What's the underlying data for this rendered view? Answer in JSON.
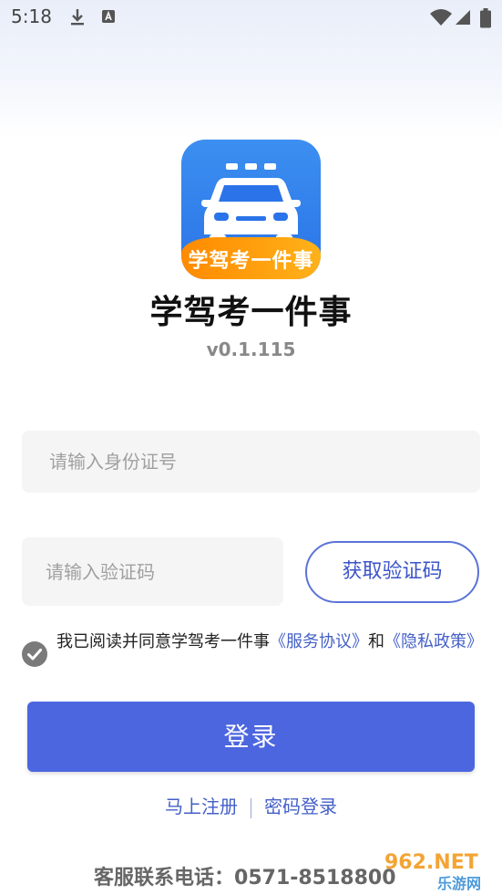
{
  "status_bar": {
    "time": "5:18",
    "icons": [
      "download-icon",
      "notification-a-icon",
      "wifi-icon",
      "signal-icon",
      "battery-icon"
    ]
  },
  "app": {
    "icon_banner_text": "学驾考一件事",
    "title": "学驾考一件事",
    "version": "v0.1.115"
  },
  "form": {
    "id_placeholder": "请输入身份证号",
    "id_value": "",
    "code_placeholder": "请输入验证码",
    "code_value": "",
    "get_code_label": "获取验证码"
  },
  "agreement": {
    "checked": true,
    "text_prefix": "我已阅读并同意学驾考一件事",
    "service_link": "《服务协议》",
    "and_text": "和",
    "privacy_link": "《隐私政策》"
  },
  "login_button": "登录",
  "links": {
    "register": "马上注册",
    "password_login": "密码登录"
  },
  "support": {
    "label": "客服联系电话：",
    "phone": "0571-8518800"
  },
  "watermark": {
    "text_top": "962.NET",
    "text_bottom": "乐游网"
  },
  "colors": {
    "primary": "#4c66e0",
    "link": "#4460c8",
    "icon_blue": "#2a73e8",
    "icon_orange": "#ff9a10"
  }
}
